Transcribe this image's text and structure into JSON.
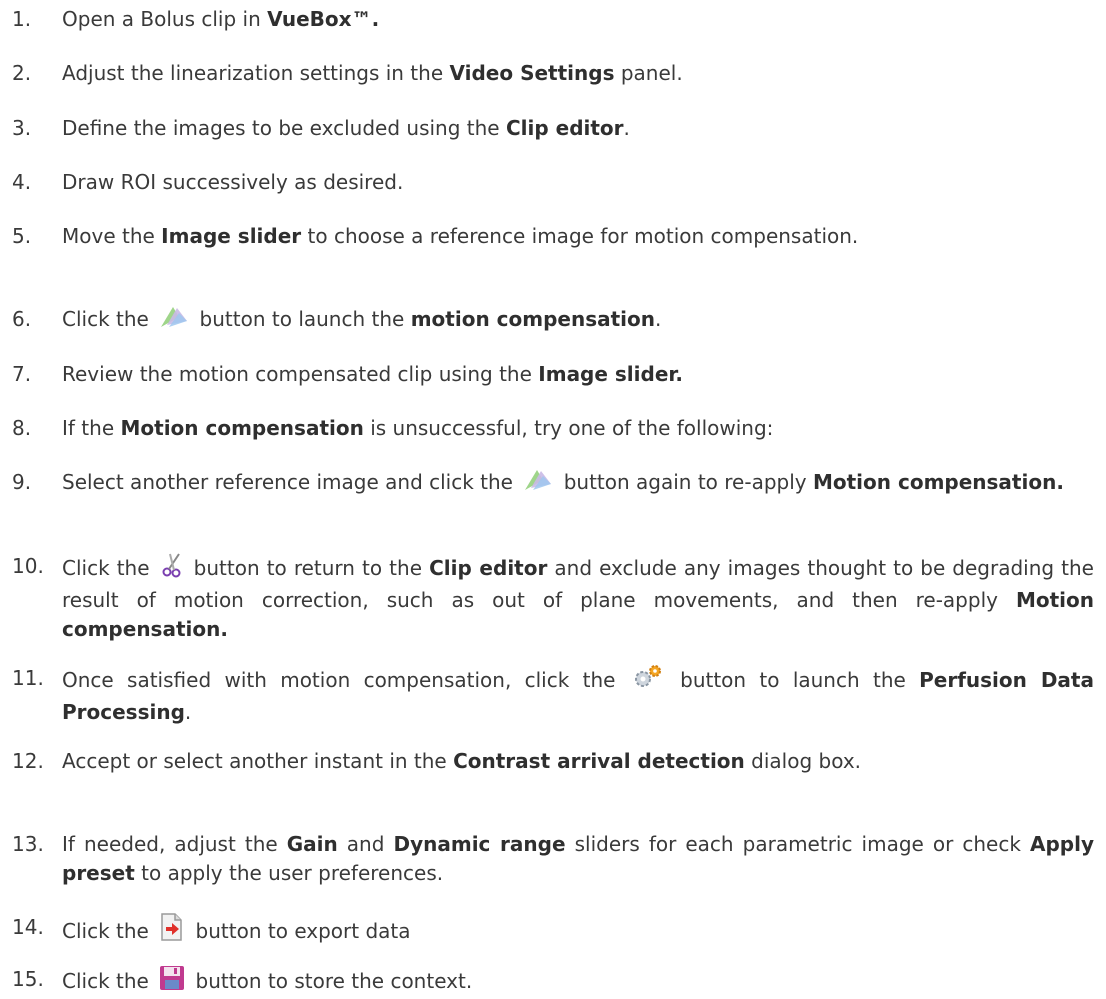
{
  "steps": [
    {
      "num": "1.",
      "parts": [
        "Open a Bolus clip in ",
        "VueBox™."
      ]
    },
    {
      "num": "2.",
      "parts": [
        "Adjust the linearization settings in the ",
        "Video Settings",
        " panel."
      ]
    },
    {
      "num": "3.",
      "parts": [
        "Define the images to be excluded using the ",
        "Clip editor",
        "."
      ]
    },
    {
      "num": "4.",
      "parts": [
        "Draw ROI successively as desired."
      ]
    },
    {
      "num": "5.",
      "parts": [
        "Move the ",
        "Image slider",
        " to choose a reference image for motion compensation."
      ]
    },
    {
      "num": "6.",
      "parts": [
        "Click the ",
        " button to launch the ",
        "motion compensation",
        "."
      ]
    },
    {
      "num": "7.",
      "parts": [
        "Review the motion compensated clip using the ",
        "Image slider."
      ]
    },
    {
      "num": "8.",
      "parts": [
        "If the ",
        "Motion compensation",
        " is unsuccessful, try one of the following:"
      ]
    },
    {
      "num": "9.",
      "parts": [
        "Select another reference image and click the ",
        " button again to re-apply ",
        "Motion compensation."
      ]
    },
    {
      "num": "10.",
      "parts": [
        "Click the ",
        " button to return to the ",
        "Clip editor",
        " and exclude any images thought to be degrading the result of motion correction, such as out of plane movements, and then re-apply ",
        "Motion compensation."
      ]
    },
    {
      "num": "11.",
      "parts": [
        "Once satisfied with motion compensation, click the ",
        " button to launch the ",
        "Perfusion Data Processing",
        "."
      ]
    },
    {
      "num": "12.",
      "parts": [
        "Accept or select another instant in the ",
        "Contrast arrival detection",
        " dialog box."
      ]
    },
    {
      "num": "13.",
      "parts": [
        "If needed, adjust the ",
        "Gain",
        " and ",
        "Dynamic range",
        " sliders for each parametric image or check ",
        "Apply preset",
        " to apply the user preferences."
      ]
    },
    {
      "num": "14.",
      "parts": [
        "Click the ",
        " button to export data"
      ]
    },
    {
      "num": "15.",
      "parts": [
        "Click the ",
        " button to store the context."
      ]
    }
  ],
  "icons": {
    "motion": "motion-compensation-icon",
    "scissors": "clip-editor-icon",
    "gear": "perfusion-processing-icon",
    "export": "export-data-icon",
    "save": "save-context-icon"
  },
  "colors": {
    "text": "#3a3a3a",
    "export_arrow": "#e0302a",
    "save_disk": "#c03a8f"
  }
}
